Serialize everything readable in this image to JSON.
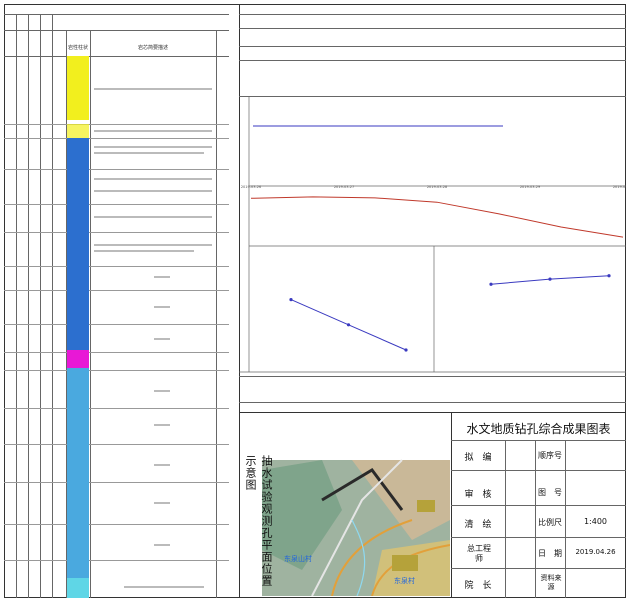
{
  "title_block": {
    "title": "水文地质钻孔综合成果图表",
    "rows": [
      {
        "label": "拟　编",
        "label2": "顺序号",
        "value": ""
      },
      {
        "label": "审　核",
        "label2": "图　号",
        "value": ""
      },
      {
        "label": "清　绘",
        "label2": "比例尺",
        "value": "1:400"
      },
      {
        "label": "总工程师",
        "label2": "日　期",
        "value": "2019.04.26"
      },
      {
        "label": "院　长",
        "label2": "资料来源",
        "value": ""
      }
    ]
  },
  "map": {
    "title": "抽水试验观测孔平面位置示意图",
    "label_1": "东泉山村",
    "label_2": "东泉村"
  },
  "lithology": {
    "header_1": "岩性柱状",
    "header_2": "岩芯简要描述"
  },
  "colors": {
    "yellow": "#f2ef1e",
    "blue": "#2c6fcf",
    "lightblue": "#4aa9df",
    "magenta": "#e818d6",
    "cyan": "#5fd6e6",
    "line_red": "#c0392b",
    "line_blue": "#3a3ac0"
  },
  "chart_data": [
    {
      "type": "line",
      "series": [
        {
          "values": [
            0.02,
            0.02,
            0.02,
            0.02,
            0.02
          ]
        }
      ],
      "ylim": [
        0,
        0.025
      ]
    },
    {
      "type": "line",
      "x_ticks": [
        "2019-03-26",
        "2019-03-27",
        "2019-03-28",
        "2019-03-29",
        "2019-03-30"
      ],
      "series": [
        {
          "values": [
            20.0,
            20.3,
            20.1,
            19.2,
            16.8,
            14.1,
            12.0
          ]
        }
      ]
    },
    {
      "type": "line",
      "series": [
        {
          "values": [
            10.2,
            8.1,
            6.0
          ]
        }
      ]
    },
    {
      "type": "line",
      "series": [
        {
          "values": [
            5.1,
            5.4,
            5.6
          ]
        }
      ]
    }
  ]
}
